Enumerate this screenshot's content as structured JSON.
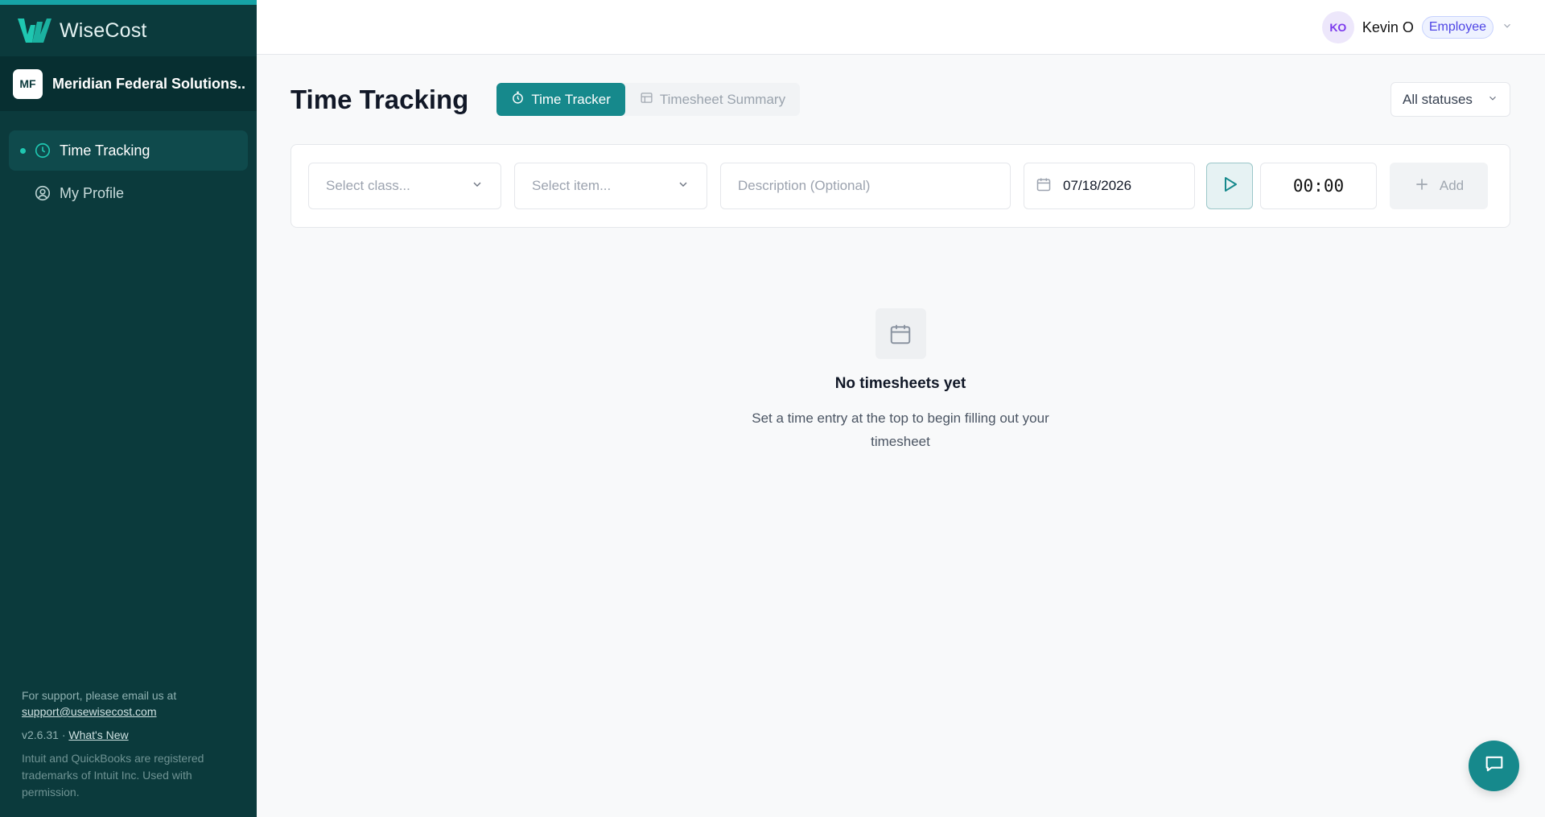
{
  "app": {
    "name": "WiseCost"
  },
  "org": {
    "initials": "MF",
    "name": "Meridian Federal Solutions..."
  },
  "sidebar": {
    "items": [
      {
        "label": "Time Tracking",
        "icon": "clock-icon",
        "active": true
      },
      {
        "label": "My Profile",
        "icon": "user-circle-icon",
        "active": false
      }
    ],
    "support_text": "For support, please email us at",
    "support_email": "support@usewisecost.com",
    "version": "v2.6.31 ·",
    "whats_new": "What's New",
    "legal": "Intuit and QuickBooks are registered trademarks of Intuit Inc. Used with permission."
  },
  "header": {
    "user_initials": "KO",
    "user_name": "Kevin O",
    "role": "Employee"
  },
  "page": {
    "title": "Time Tracking",
    "tabs": [
      {
        "label": "Time Tracker",
        "icon": "stopwatch-icon",
        "active": true
      },
      {
        "label": "Timesheet Summary",
        "icon": "table-icon",
        "active": false
      }
    ],
    "status_filter": "All statuses"
  },
  "entry": {
    "class_placeholder": "Select class...",
    "item_placeholder": "Select item...",
    "description_placeholder": "Description (Optional)",
    "date": "07/18/2026",
    "timer": "00:00",
    "add_label": "Add"
  },
  "empty_state": {
    "title": "No timesheets yet",
    "description": "Set a time entry at the top to begin filling out your timesheet"
  },
  "colors": {
    "sidebar_bg": "#0b3a3c",
    "accent": "#16898c",
    "accent_bright": "#1fc7b1",
    "role_badge": "#4f46e5",
    "avatar": "#7c3aed"
  }
}
